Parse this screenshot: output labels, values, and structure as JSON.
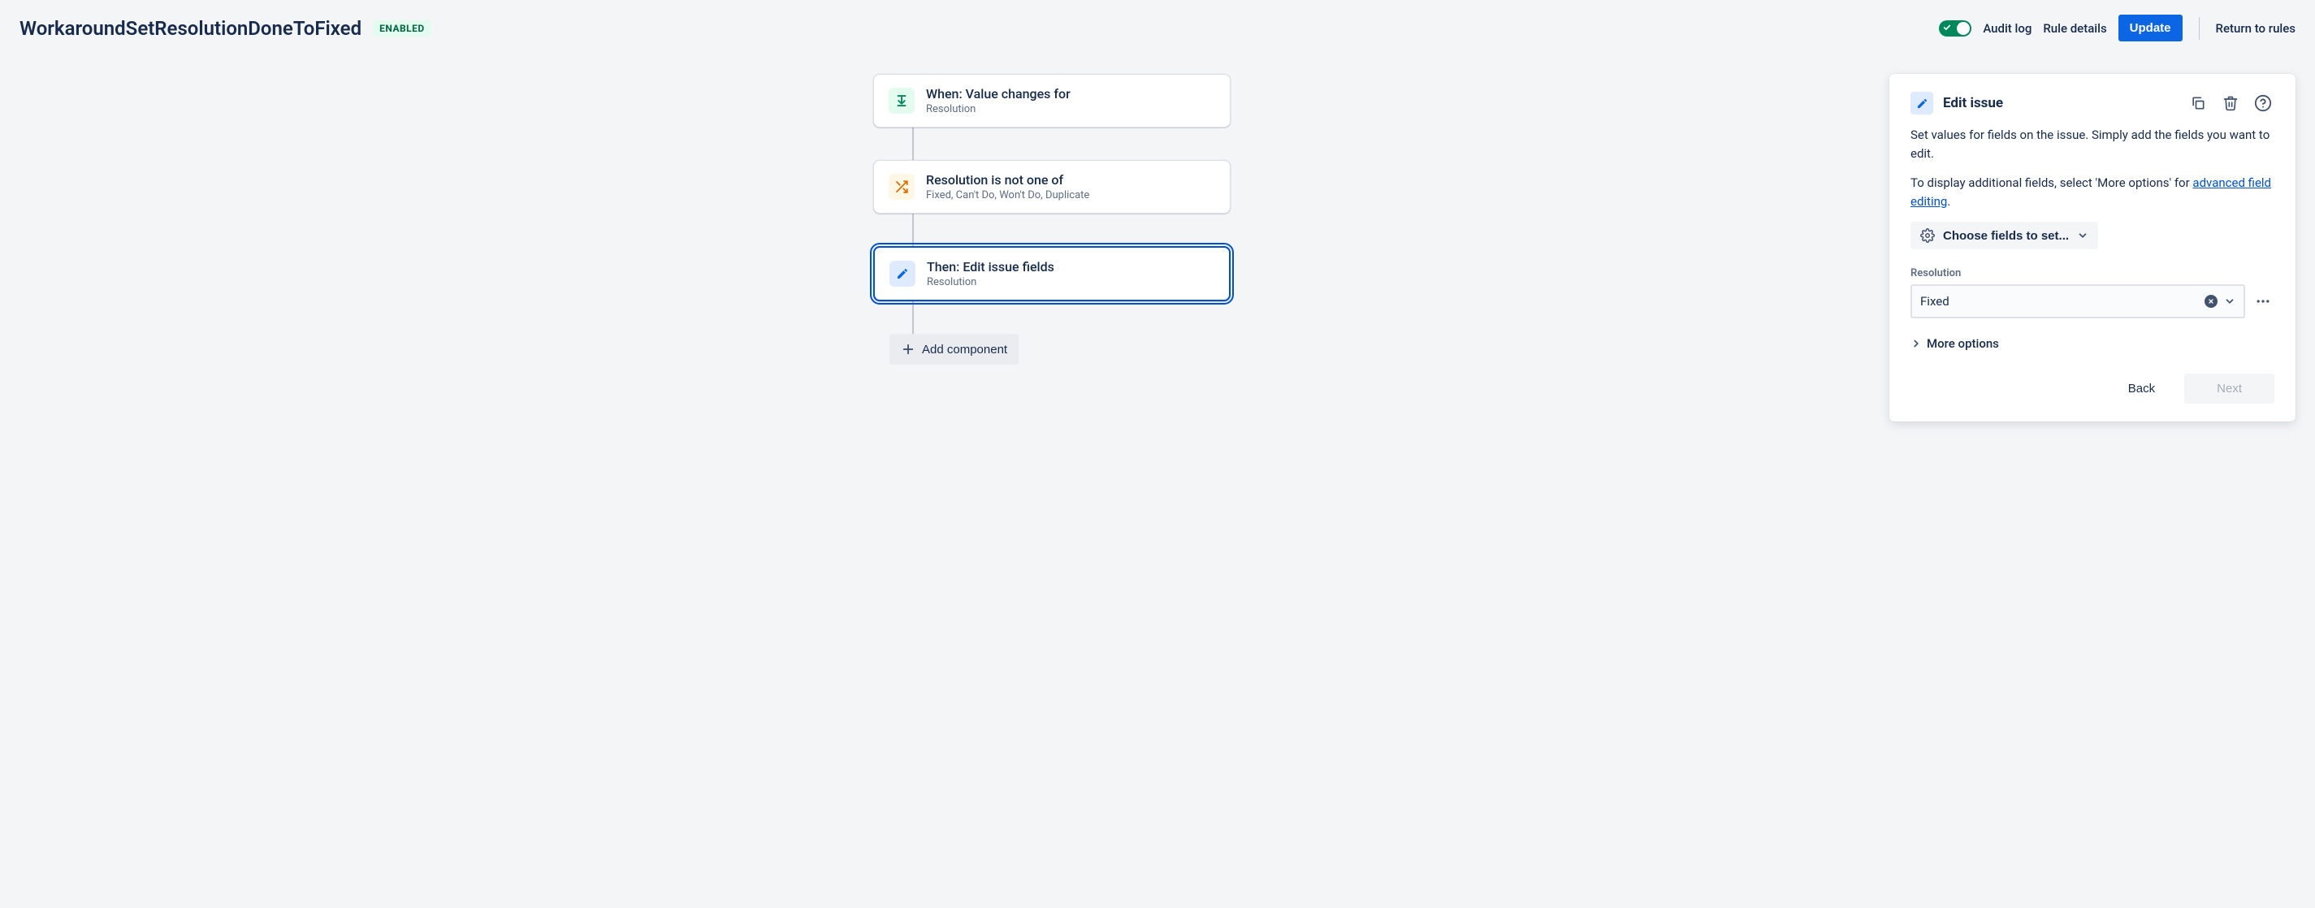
{
  "header": {
    "title": "WorkaroundSetResolutionDoneToFixed",
    "status_label": "ENABLED",
    "audit_log": "Audit log",
    "rule_details": "Rule details",
    "update": "Update",
    "return": "Return to rules"
  },
  "flow": {
    "trigger": {
      "title": "When: Value changes for",
      "sub": "Resolution"
    },
    "condition": {
      "title": "Resolution is not one of",
      "sub": "Fixed, Can't Do, Won't Do, Duplicate"
    },
    "action": {
      "title": "Then: Edit issue fields",
      "sub": "Resolution"
    },
    "add_component": "Add component"
  },
  "panel": {
    "title": "Edit issue",
    "desc1": "Set values for fields on the issue. Simply add the fields you want to edit.",
    "desc2_prefix": "To display additional fields, select 'More options' for ",
    "desc2_link": "advanced field editing",
    "choose_fields": "Choose fields to set...",
    "field_label": "Resolution",
    "field_value": "Fixed",
    "more_options": "More options",
    "back": "Back",
    "next": "Next"
  }
}
